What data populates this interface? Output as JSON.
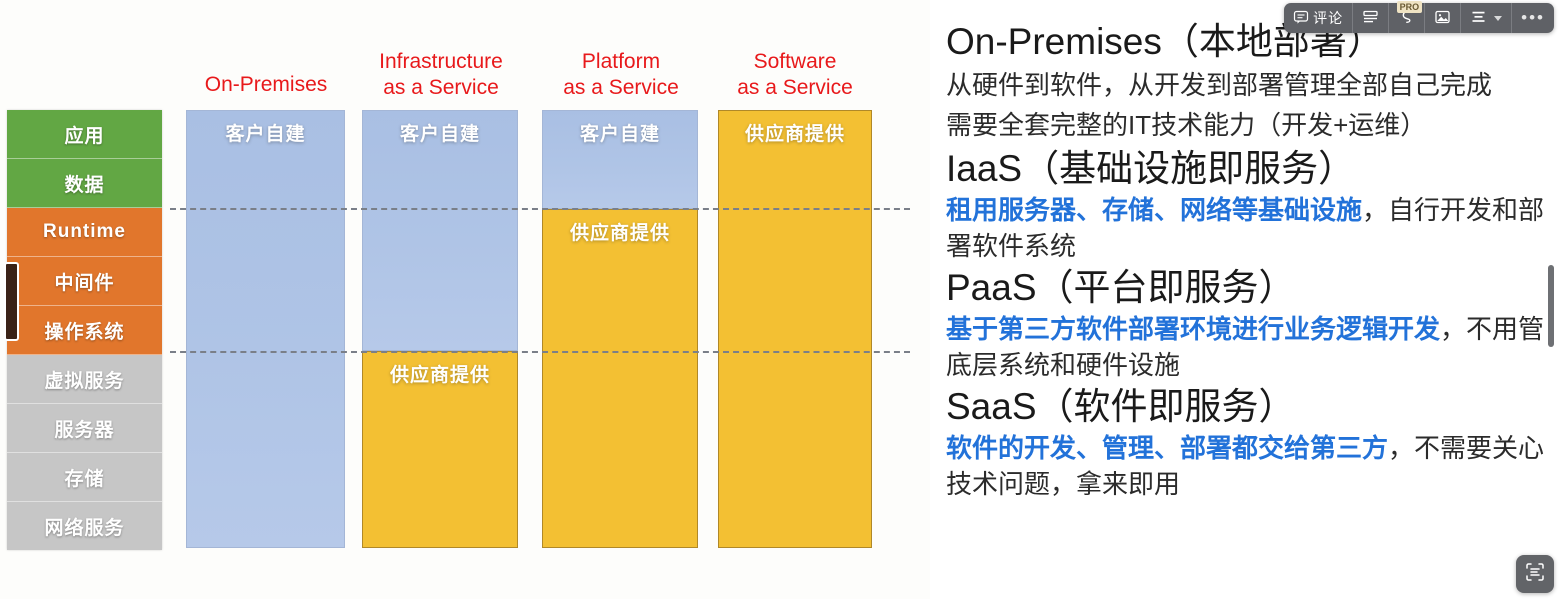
{
  "toolbar": {
    "comment_icon": "comment-icon",
    "comment_label": "评论",
    "layout_icon": "layout-icon",
    "highlight_icon": "highlight-pen-icon",
    "pro_badge": "PRO",
    "image_icon": "image-icon",
    "align_icon": "align-icon",
    "more_icon": "more-icon",
    "more_label": "•••"
  },
  "scan_button": {
    "icon": "scan-text-icon"
  },
  "diagram": {
    "stack_title": "service-layers",
    "layers": [
      {
        "label": "应用",
        "color": "#62a744",
        "group": "green"
      },
      {
        "label": "数据",
        "color": "#62a744",
        "group": "green"
      },
      {
        "label": "Runtime",
        "color": "#e1762c",
        "group": "orange"
      },
      {
        "label": "中间件",
        "color": "#e1762c",
        "group": "orange"
      },
      {
        "label": "操作系统",
        "color": "#e1762c",
        "group": "orange"
      },
      {
        "label": "虚拟服务",
        "color": "#c6c6c6",
        "group": "grey"
      },
      {
        "label": "服务器",
        "color": "#c6c6c6",
        "group": "grey"
      },
      {
        "label": "存储",
        "color": "#c6c6c6",
        "group": "grey"
      },
      {
        "label": "网络服务",
        "color": "#c6c6c6",
        "group": "grey"
      }
    ],
    "columns": [
      {
        "header": "On-Premises",
        "segments": [
          {
            "label": "客户自建",
            "fill": "blue",
            "ratio": 1.0
          }
        ]
      },
      {
        "header": "Infrastructure\nas a Service",
        "segments": [
          {
            "label": "客户自建",
            "fill": "blue",
            "ratio": 0.55
          },
          {
            "label": "供应商提供",
            "fill": "gold",
            "ratio": 0.45
          }
        ]
      },
      {
        "header": "Platform\nas a Service",
        "segments": [
          {
            "label": "客户自建",
            "fill": "blue",
            "ratio": 0.225
          },
          {
            "label": "供应商提供",
            "fill": "gold",
            "ratio": 0.775
          }
        ]
      },
      {
        "header": "Software\nas a Service",
        "segments": [
          {
            "label": "供应商提供",
            "fill": "gold",
            "ratio": 1.0
          }
        ]
      }
    ],
    "colors": {
      "header_red": "#e8191b",
      "customer_blue": "#afc4e6",
      "vendor_gold": "#f3c033",
      "green": "#62a744",
      "orange": "#e1762c",
      "grey": "#c6c6c6"
    }
  },
  "notes": {
    "sections": [
      {
        "heading": "On-Premises（本地部署）",
        "lines": [
          {
            "plain": "从硬件到软件，从开发到部署管理全部自己完成"
          },
          {
            "plain": "需要全套完整的IT技术能力（开发+运维）"
          }
        ]
      },
      {
        "heading": "IaaS（基础设施即服务）",
        "lines": [
          {
            "highlight": "租用服务器、存储、网络等基础设施",
            "plain": "，自行开发和部署软件系统"
          }
        ]
      },
      {
        "heading": "PaaS（平台即服务）",
        "lines": [
          {
            "highlight": "基于第三方软件部署环境进行业务逻辑开发",
            "plain": "，不用管底层系统和硬件设施"
          }
        ]
      },
      {
        "heading": "SaaS（软件即服务）",
        "lines": [
          {
            "highlight": "软件的开发、管理、部署都交给第三方",
            "plain": "，不需要关心技术问题，拿来即用"
          }
        ]
      }
    ]
  }
}
